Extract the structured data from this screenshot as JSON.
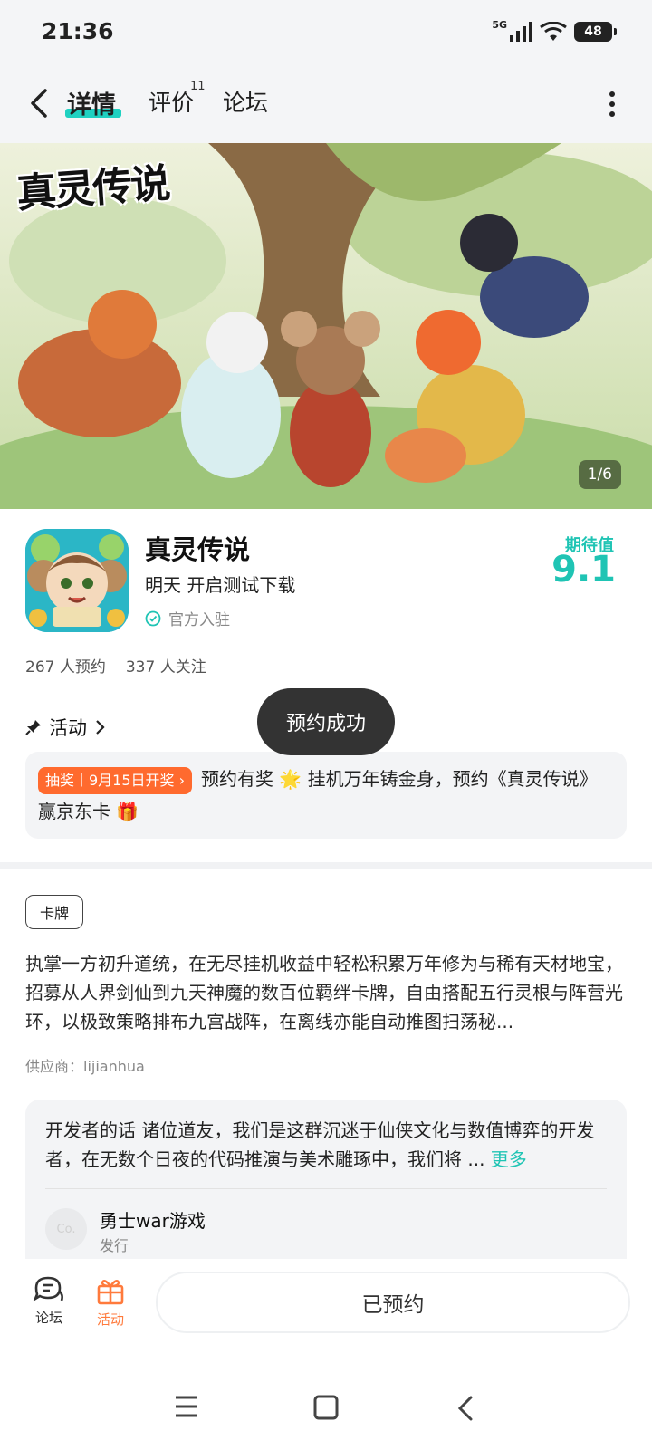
{
  "status_bar": {
    "time": "21:36",
    "network": "5G",
    "battery": "48"
  },
  "nav": {
    "tabs": [
      {
        "label": "详情"
      },
      {
        "label": "评价"
      },
      {
        "label": "论坛"
      }
    ],
    "review_count": "11"
  },
  "banner": {
    "logo_text": "真灵传说",
    "counter": "1/6"
  },
  "app": {
    "name": "真灵传说",
    "subtitle": "明天 开启测试下载",
    "official": "官方入驻",
    "expect_label": "期待值",
    "expect_score": "9.1"
  },
  "stats": {
    "reservations": "267 人预约",
    "followers": "337 人关注"
  },
  "activity": {
    "heading": "活动",
    "tag": "抽奖丨9月15日开奖 ›",
    "text_1": "预约有奖 🌟 挂机万年铸金身，预约《真灵传说》赢京东卡 🎁"
  },
  "toast": "预约成功",
  "category_tag": "卡牌",
  "description": "执掌一方初升道统，在无尽挂机收益中轻松积累万年修为与稀有天材地宝，招募从人界剑仙到九天神魔的数百位羁绊卡牌，自由搭配五行灵根与阵营光环，以极致策略排布九宫战阵，在离线亦能自动推图扫荡秘...",
  "supplier": "供应商：lijianhua",
  "developer": {
    "message": "开发者的话  诸位道友，我们是这群沉迷于仙侠文化与数值博弈的开发者，在无数个日夜的代码推演与美术雕琢中，我们将 ...",
    "more": "更多",
    "avatar_text": "Co.",
    "name": "勇士war游戏",
    "role": "发行"
  },
  "bottom_bar": {
    "forum_label": "论坛",
    "activity_label": "活动",
    "action_label": "已预约"
  },
  "colors": {
    "accent": "#1fc4b4",
    "orange": "#ff6a2e",
    "toast_bg": "#333333"
  }
}
